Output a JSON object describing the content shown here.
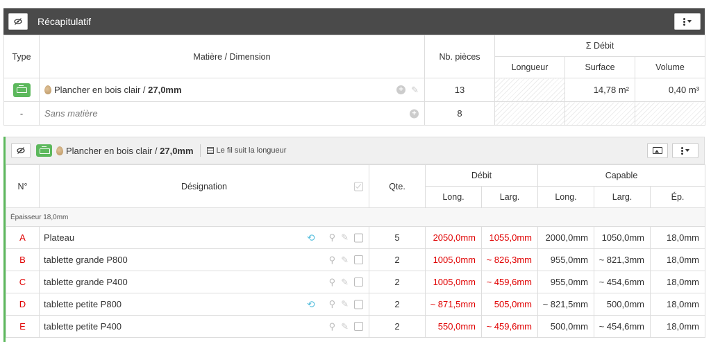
{
  "summary": {
    "title": "Récapitulatif",
    "columns": {
      "type": "Type",
      "material": "Matière / Dimension",
      "pieces": "Nb. pièces",
      "debit": "Σ Débit",
      "length": "Longueur",
      "surface": "Surface",
      "volume": "Volume"
    },
    "rows": [
      {
        "type": "",
        "material_name": "Plancher en bois clair / ",
        "material_thickness": "27,0mm",
        "pieces": "13",
        "length": "",
        "surface": "14,78 m²",
        "volume": "0,40 m³"
      },
      {
        "type": "-",
        "material_name": "Sans matière",
        "material_thickness": "",
        "pieces": "8",
        "length": "",
        "surface": "",
        "volume": ""
      }
    ]
  },
  "group": {
    "material_name": "Plancher en bois clair / ",
    "material_thickness": "27,0mm",
    "grain_label": "Le fil suit la longueur",
    "columns": {
      "num": "N°",
      "designation": "Désignation",
      "qty": "Qte.",
      "debit": "Débit",
      "capable": "Capable",
      "debit_long": "Long.",
      "debit_larg": "Larg.",
      "cap_long": "Long.",
      "cap_larg": "Larg.",
      "cap_ep": "Ép."
    },
    "thickness_label": "Épaisseur 18,0mm",
    "parts": [
      {
        "num": "A",
        "name": "Plateau",
        "qty": "5",
        "debit_long": "2050,0mm",
        "debit_larg": "1055,0mm",
        "cap_long": "2000,0mm",
        "cap_larg": "1050,0mm",
        "cap_ep": "18,0mm"
      },
      {
        "num": "B",
        "name": "tablette grande P800",
        "qty": "2",
        "debit_long": "1005,0mm",
        "debit_larg": "~ 826,3mm",
        "cap_long": "955,0mm",
        "cap_larg": "~ 821,3mm",
        "cap_ep": "18,0mm"
      },
      {
        "num": "C",
        "name": "tablette grande P400",
        "qty": "2",
        "debit_long": "1005,0mm",
        "debit_larg": "~ 459,6mm",
        "cap_long": "955,0mm",
        "cap_larg": "~ 454,6mm",
        "cap_ep": "18,0mm"
      },
      {
        "num": "D",
        "name": "tablette petite P800",
        "qty": "2",
        "debit_long": "~ 871,5mm",
        "debit_larg": "505,0mm",
        "cap_long": "~ 821,5mm",
        "cap_larg": "500,0mm",
        "cap_ep": "18,0mm"
      },
      {
        "num": "E",
        "name": "tablette petite P400",
        "qty": "2",
        "debit_long": "550,0mm",
        "debit_larg": "~ 459,6mm",
        "cap_long": "500,0mm",
        "cap_larg": "~ 454,6mm",
        "cap_ep": "18,0mm"
      }
    ]
  },
  "colors": {
    "accent_green": "#5cb85c",
    "header_dark": "#4a4a4a",
    "value_red": "#e00000",
    "rotate_blue": "#5bc0de"
  },
  "icons": {
    "visibility": "eye-slash-icon",
    "menu": "ellipsis-vertical-icon",
    "material_type": "panel-icon",
    "wood": "wood-drop-icon",
    "add": "plus-circle-icon",
    "edit": "pencil-icon",
    "rotate": "rotate-icon",
    "highlight": "magnifier-icon",
    "grain": "grain-icon",
    "image": "image-icon"
  }
}
